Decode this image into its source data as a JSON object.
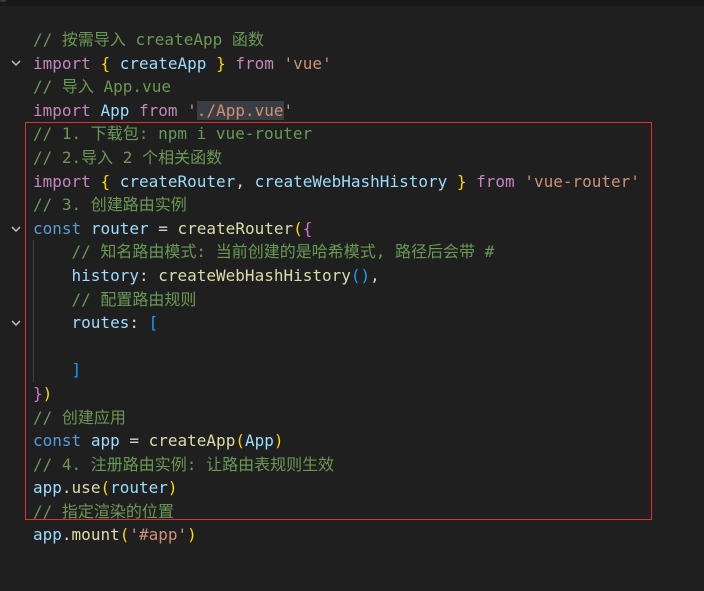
{
  "lines": [
    {
      "fold": false,
      "tokens": [
        [
          "c-com",
          "// 按需导入 createApp 函数"
        ]
      ]
    },
    {
      "fold": true,
      "tokens": [
        [
          "c-kw",
          "import"
        ],
        [
          "c-ply",
          " "
        ],
        [
          "c-br1",
          "{"
        ],
        [
          "c-ply",
          " "
        ],
        [
          "c-var",
          "createApp"
        ],
        [
          "c-ply",
          " "
        ],
        [
          "c-br1",
          "}"
        ],
        [
          "c-ply",
          " "
        ],
        [
          "c-kw",
          "from"
        ],
        [
          "c-ply",
          " "
        ],
        [
          "c-str",
          "'vue'"
        ]
      ]
    },
    {
      "fold": false,
      "tokens": [
        [
          "c-com",
          "// 导入 App.vue"
        ]
      ]
    },
    {
      "fold": false,
      "tokens": [
        [
          "c-kw",
          "import"
        ],
        [
          "c-ply",
          " "
        ],
        [
          "c-var",
          "App"
        ],
        [
          "c-ply",
          " "
        ],
        [
          "c-kw",
          "from"
        ],
        [
          "c-ply",
          " "
        ],
        [
          "c-str",
          "'"
        ],
        [
          "c-str sel-bg",
          "./App.vue"
        ],
        [
          "c-str",
          "'"
        ]
      ]
    },
    {
      "fold": false,
      "tokens": [
        [
          "c-com",
          "// 1. 下载包: npm i vue-router"
        ]
      ]
    },
    {
      "fold": false,
      "tokens": [
        [
          "c-com",
          "// 2.导入 2 个相关函数"
        ]
      ]
    },
    {
      "fold": false,
      "tokens": [
        [
          "c-kw",
          "import"
        ],
        [
          "c-ply",
          " "
        ],
        [
          "c-br1",
          "{"
        ],
        [
          "c-ply",
          " "
        ],
        [
          "c-var",
          "createRouter"
        ],
        [
          "c-ply",
          ", "
        ],
        [
          "c-var",
          "createWebHashHistory"
        ],
        [
          "c-ply",
          " "
        ],
        [
          "c-br1",
          "}"
        ],
        [
          "c-ply",
          " "
        ],
        [
          "c-kw",
          "from"
        ],
        [
          "c-ply",
          " "
        ],
        [
          "c-str",
          "'vue-router'"
        ]
      ]
    },
    {
      "fold": false,
      "tokens": [
        [
          "c-com",
          "// 3. 创建路由实例"
        ]
      ]
    },
    {
      "fold": true,
      "tokens": [
        [
          "c-kw2",
          "const"
        ],
        [
          "c-ply",
          " "
        ],
        [
          "c-var",
          "router"
        ],
        [
          "c-ply",
          " = "
        ],
        [
          "c-fn",
          "createRouter"
        ],
        [
          "c-br1",
          "("
        ],
        [
          "c-br2",
          "{"
        ]
      ]
    },
    {
      "fold": false,
      "tokens": [
        [
          "c-ply",
          "    "
        ],
        [
          "c-com",
          "// 知名路由模式: 当前创建的是哈希模式, 路径后会带 #"
        ]
      ]
    },
    {
      "fold": false,
      "tokens": [
        [
          "c-ply",
          "    "
        ],
        [
          "c-var",
          "history"
        ],
        [
          "c-ply",
          ": "
        ],
        [
          "c-fn",
          "createWebHashHistory"
        ],
        [
          "c-br3",
          "()"
        ],
        [
          "c-ply",
          ","
        ]
      ]
    },
    {
      "fold": false,
      "tokens": [
        [
          "c-ply",
          "    "
        ],
        [
          "c-com",
          "// 配置路由规则"
        ]
      ]
    },
    {
      "fold": true,
      "tokens": [
        [
          "c-ply",
          "    "
        ],
        [
          "c-var",
          "routes"
        ],
        [
          "c-ply",
          ": "
        ],
        [
          "c-br3",
          "["
        ]
      ]
    },
    {
      "fold": false,
      "tokens": [
        [
          "c-ply",
          ""
        ]
      ]
    },
    {
      "fold": false,
      "tokens": [
        [
          "c-ply",
          "    "
        ],
        [
          "c-br3",
          "]"
        ]
      ]
    },
    {
      "fold": false,
      "tokens": [
        [
          "c-br2",
          "}"
        ],
        [
          "c-br1",
          ")"
        ]
      ]
    },
    {
      "fold": false,
      "tokens": [
        [
          "c-com",
          "// 创建应用"
        ]
      ]
    },
    {
      "fold": false,
      "tokens": [
        [
          "c-kw2",
          "const"
        ],
        [
          "c-ply",
          " "
        ],
        [
          "c-var",
          "app"
        ],
        [
          "c-ply",
          " = "
        ],
        [
          "c-fn",
          "createApp"
        ],
        [
          "c-br1",
          "("
        ],
        [
          "c-var",
          "App"
        ],
        [
          "c-br1",
          ")"
        ]
      ]
    },
    {
      "fold": false,
      "tokens": [
        [
          "c-com",
          "// 4. 注册路由实例: 让路由表规则生效"
        ]
      ]
    },
    {
      "fold": false,
      "tokens": [
        [
          "c-var",
          "app"
        ],
        [
          "c-ply",
          "."
        ],
        [
          "c-fn",
          "use"
        ],
        [
          "c-br1",
          "("
        ],
        [
          "c-var",
          "router"
        ],
        [
          "c-br1",
          ")"
        ]
      ]
    },
    {
      "fold": false,
      "tokens": [
        [
          "c-com",
          "// 指定渲染的位置"
        ]
      ]
    },
    {
      "fold": false,
      "tokens": [
        [
          "c-var",
          "app"
        ],
        [
          "c-ply",
          "."
        ],
        [
          "c-fn",
          "mount"
        ],
        [
          "c-br1",
          "("
        ],
        [
          "c-str",
          "'#app'"
        ],
        [
          "c-br1",
          ")"
        ]
      ]
    }
  ]
}
